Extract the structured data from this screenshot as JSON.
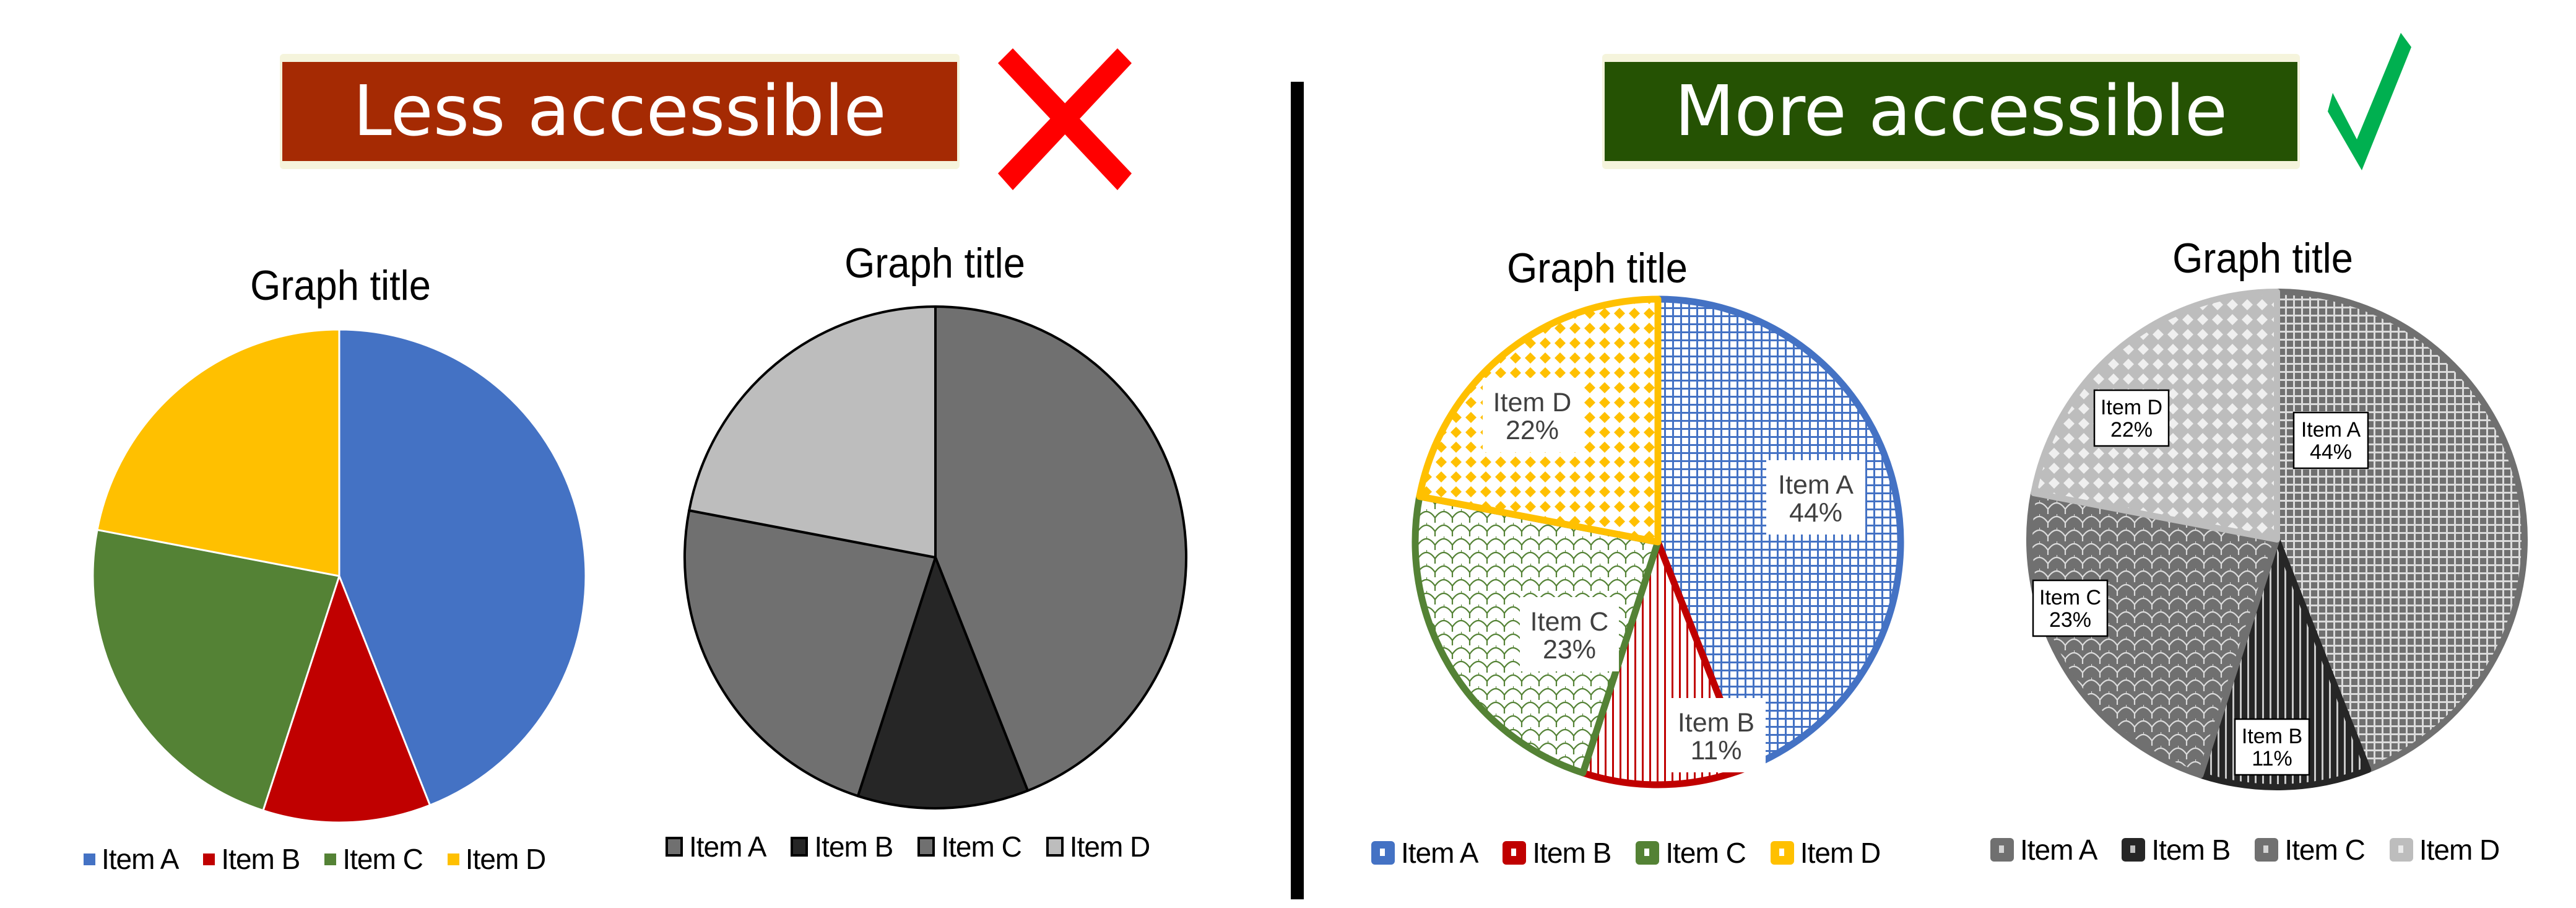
{
  "left_panel": {
    "banner_label": "Less accessible",
    "banner_color": "#a52a03",
    "verdict_icon": "cross-icon",
    "verdict_color": "#ff0000"
  },
  "right_panel": {
    "banner_label": "More accessible",
    "banner_color": "#255203",
    "verdict_icon": "checkmark-icon",
    "verdict_color": "#00b050"
  },
  "chart_data": [
    {
      "id": "color-pie",
      "type": "pie",
      "title": "Graph title",
      "style": "solid color fills, no data labels",
      "categories": [
        "Item A",
        "Item B",
        "Item C",
        "Item D"
      ],
      "values": [
        44,
        11,
        23,
        22
      ],
      "unit": "%",
      "colors": [
        "#4472c4",
        "#c00000",
        "#548235",
        "#ffc000"
      ],
      "slice_border": "#ffffff",
      "data_labels": false,
      "legend": "bottom"
    },
    {
      "id": "grayscale-pie",
      "type": "pie",
      "title": "Graph title",
      "style": "grayscale solid fills with black outlines, no data labels",
      "categories": [
        "Item A",
        "Item B",
        "Item C",
        "Item D"
      ],
      "values": [
        44,
        11,
        23,
        22
      ],
      "unit": "%",
      "colors": [
        "#707070",
        "#262626",
        "#707070",
        "#bdbdbd"
      ],
      "slice_border": "#000000",
      "data_labels": false,
      "legend": "bottom"
    },
    {
      "id": "pattern-color-pie",
      "type": "pie",
      "title": "Graph title",
      "style": "color pattern fills with thick colored borders and data labels",
      "categories": [
        "Item A",
        "Item B",
        "Item C",
        "Item D"
      ],
      "values": [
        44,
        11,
        23,
        22
      ],
      "unit": "%",
      "colors": [
        "#4472c4",
        "#c00000",
        "#548235",
        "#ffc000"
      ],
      "patterns": [
        "grid",
        "vertical-lines",
        "scales",
        "diamonds"
      ],
      "data_labels": [
        "Item A 44%",
        "Item B 11%",
        "Item C 23%",
        "Item D 22%"
      ],
      "label_text_color": "#404040",
      "legend": "bottom"
    },
    {
      "id": "pattern-grayscale-pie",
      "type": "pie",
      "title": "Graph title",
      "style": "grayscale pattern fills with boxed data labels",
      "categories": [
        "Item A",
        "Item B",
        "Item C",
        "Item D"
      ],
      "values": [
        44,
        11,
        23,
        22
      ],
      "unit": "%",
      "colors": [
        "#707070",
        "#262626",
        "#707070",
        "#bdbdbd"
      ],
      "patterns": [
        "grid",
        "vertical-lines",
        "scales",
        "diamonds"
      ],
      "data_labels": [
        "Item A 44%",
        "Item B 11%",
        "Item C 23%",
        "Item D 22%"
      ],
      "label_text_color": "#000000",
      "legend": "bottom"
    }
  ]
}
